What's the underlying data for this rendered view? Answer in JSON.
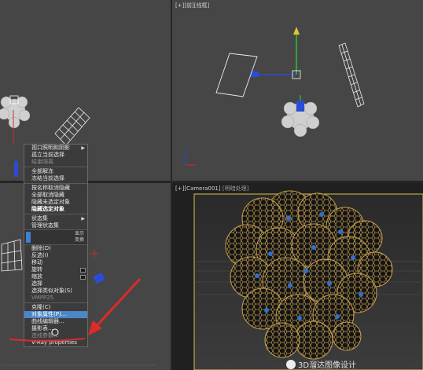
{
  "viewports": {
    "top_right": {
      "label": "[+][前][线框]"
    },
    "bottom_right": {
      "label": "[+][Camera001]",
      "mode": "[明暗处理]"
    }
  },
  "context_menu": {
    "upper_items": [
      {
        "label": "视口照明和阴影",
        "state": "normal",
        "arrow": true
      },
      {
        "label": "孤立当前选择",
        "state": "normal"
      },
      {
        "label": "结束隔离",
        "state": "disabled"
      },
      {
        "label": "全部解冻",
        "state": "normal"
      },
      {
        "label": "冻结当前选择",
        "state": "normal"
      },
      {
        "label": "按名称取消隐藏",
        "state": "normal"
      },
      {
        "label": "全部取消隐藏",
        "state": "normal"
      },
      {
        "label": "隐藏未选定对象",
        "state": "normal"
      },
      {
        "label": "隐藏选定对象",
        "state": "bold"
      },
      {
        "label": "状态集",
        "state": "normal",
        "arrow": true
      },
      {
        "label": "管理状态集",
        "state": "normal"
      }
    ],
    "quad_labels": {
      "tools_label": "显示",
      "transform_label": "变换"
    },
    "lower_items": [
      {
        "label": "删除(D)",
        "state": "normal"
      },
      {
        "label": "反选(I)",
        "state": "normal"
      },
      {
        "label": "移动",
        "state": "normal"
      },
      {
        "label": "旋转",
        "state": "normal",
        "option": true
      },
      {
        "label": "缩放",
        "state": "normal",
        "option": true
      },
      {
        "label": "选择",
        "state": "normal"
      },
      {
        "label": "选择类似对象(S)",
        "state": "normal"
      },
      {
        "label": "VMPP25",
        "state": "disabled"
      },
      {
        "label": "克隆(C)",
        "state": "normal"
      },
      {
        "label": "对象属性(P)...",
        "state": "highlight"
      },
      {
        "label": "曲线编辑器...",
        "state": "normal"
      },
      {
        "label": "摄影表...",
        "state": "normal"
      },
      {
        "label": "连线参数...",
        "state": "disabled"
      },
      {
        "label": "V-Ray properties",
        "state": "normal"
      }
    ]
  },
  "watermark": {
    "text": "3D溜达图像设计"
  },
  "colors": {
    "highlight": "#4a87c9",
    "annotation": "#e02a2a",
    "gizmo_y": "#2fc42f",
    "gizmo_x": "#2a4cd6"
  }
}
